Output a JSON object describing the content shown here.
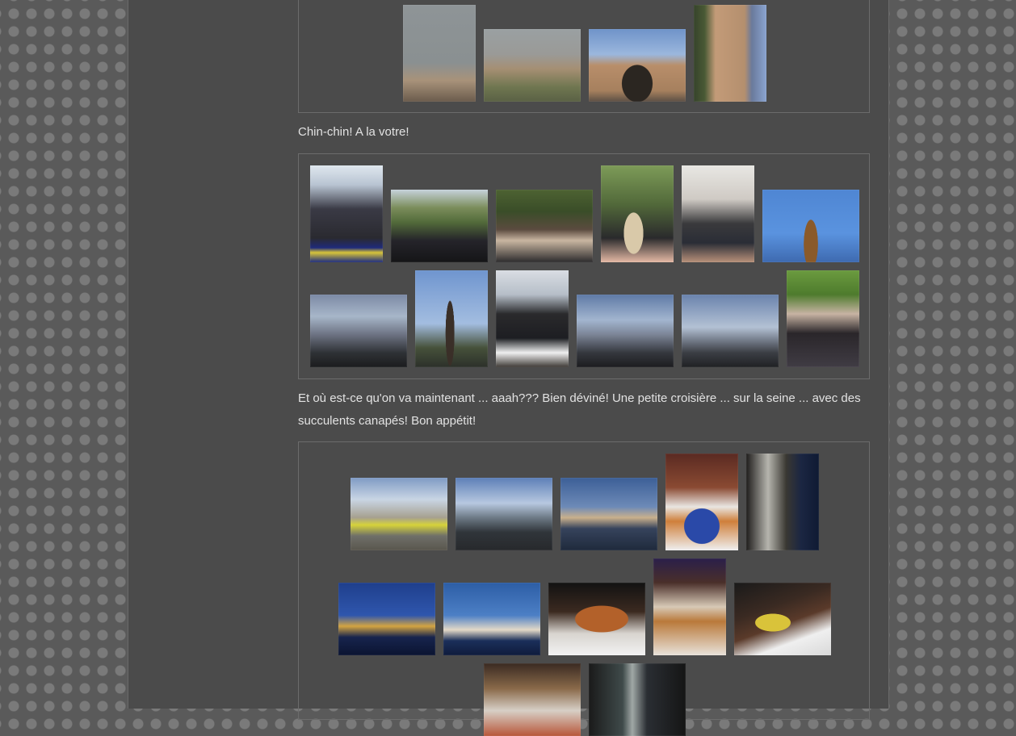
{
  "texts": {
    "caption_chinchin": "Chin-chin! A la votre!",
    "caption_croisiere": "Et où est-ce qu'on va maintenant ... aaah??? Bien déviné! Une petite croisière ... sur la seine ... avec des succulents canapés! Bon appétit!"
  },
  "gallery_top": {
    "photos": [
      {
        "name": "photo-paris-skyline-view",
        "bg": "linear-gradient(180deg,#8e9497 0%,#8a9091 60%,#a8927a 78%,#6b5c4d 100%)"
      },
      {
        "name": "photo-champs-elysees-aerial",
        "bg": "linear-gradient(180deg,#9aa0a2 0%,#9a9a97 35%,#a58f73 55%,#6f7650 80%,#5a6145 100%)"
      },
      {
        "name": "photo-arc-de-triomphe-front",
        "bg": "radial-gradient(ellipse 26% 42% at 50% 75%,#2b2621 60%,transparent 62%),linear-gradient(180deg,#6f93c9 0%,#9bb7dd 35%,#b88e6a 50%,#a6805e 85%,#5c4f45 100%)"
      },
      {
        "name": "photo-arc-de-triomphe-street",
        "bg": "linear-gradient(90deg,#36432b 0%,#4a5a35 15%,#c39b78 30%,#b48f6e 70%,#6a7a9c 80%,#8aa4d0 100%)"
      }
    ]
  },
  "gallery_bus": {
    "photos": [
      {
        "name": "photo-bus-upper-deck",
        "bg": "linear-gradient(180deg,#dfe7ee 0%,#b8c4d2 20%,#3a3a45 45%,#2a2a30 75%,#1f2a7a 85%,#d7c43a 90%,#1d2b7d 100%)"
      },
      {
        "name": "photo-bus-passengers-trees",
        "bg": "linear-gradient(180deg,#c6d2db 0%,#7b8d5b 25%,#526a3a 45%,#25242a 70%,#151517 100%)"
      },
      {
        "name": "photo-group-selfie-bus",
        "bg": "linear-gradient(180deg,#4d6232 0%,#3a4d28 30%,#5b4b3f 55%,#c9b6a1 70%,#2c2b2d 100%)"
      },
      {
        "name": "photo-champagne-glass",
        "bg": "radial-gradient(ellipse 22% 35% at 45% 70%,#d9c9a9 60%,transparent 62%),linear-gradient(180deg,#7d9b58 0%,#52693a 40%,#2a2a2c 75%,#e5b9a5 100%)"
      },
      {
        "name": "photo-toast-hands",
        "bg": "linear-gradient(180deg,#e8e7e3 0%,#cfcac4 35%,#3a3a3c 60%,#2a2d36 80%,#b8917a 100%)"
      },
      {
        "name": "photo-eiffel-tower-evening",
        "bg": "radial-gradient(ellipse 12% 55% at 50% 75%,#8a5a2a 60%,transparent 62%),linear-gradient(180deg,#4f86d3 0%,#5a93df 60%,#3e6ab0 100%)"
      },
      {
        "name": "photo-dusk-square",
        "bg": "linear-gradient(180deg,#7c8aa5 0%,#a7b6c9 30%,#6d7383 55%,#2f3236 80%,#1b1c1e 100%)"
      },
      {
        "name": "photo-eiffel-tower-tall",
        "bg": "radial-gradient(ellipse 10% 55% at 48% 65%,#3a2f28 60%,transparent 62%),linear-gradient(180deg,#6f95cf 0%,#a3bde0 55%,#46513a 80%,#2c302a 100%)"
      },
      {
        "name": "photo-woman-pouring",
        "bg": "linear-gradient(180deg,#d9dde3 0%,#b6bec8 25%,#2a2a2c 45%,#1d1e22 70%,#f0f0f0 85%,#3e3a36 100%)"
      },
      {
        "name": "photo-bridge-dusk",
        "bg": "linear-gradient(180deg,#5f7aa6 0%,#a2b5cf 35%,#7c8597 55%,#35383e 80%,#1c1c1f 100%)"
      },
      {
        "name": "photo-river-dusk",
        "bg": "linear-gradient(180deg,#6a83ad 0%,#b3c1d4 45%,#7e8796 60%,#3b3e44 80%,#202124 100%)"
      },
      {
        "name": "photo-woman-drinking",
        "bg": "linear-gradient(180deg,#6b9b3f 0%,#4e7b2d 25%,#c7b3a3 45%,#2a262a 65%,#403c44 100%)"
      }
    ]
  },
  "gallery_cruise": {
    "photos": [
      {
        "name": "photo-riverbank-building",
        "bg": "linear-gradient(180deg,#7f9bc4 0%,#c9d5e4 30%,#a6a08f 55%,#d6d33a 65%,#6f6f69 80%,#59564d 100%)"
      },
      {
        "name": "photo-boat-quay",
        "bg": "linear-gradient(180deg,#5d7fb7 0%,#b7c8e0 35%,#6d7a86 55%,#30353a 75%,#27292c 100%)"
      },
      {
        "name": "photo-seine-sunset",
        "bg": "linear-gradient(180deg,#3c5f97 0%,#6d8ab7 40%,#c9b08c 55%,#36435c 70%,#1f2a3c 100%)"
      },
      {
        "name": "photo-canapes-platter",
        "bg": "radial-gradient(ellipse 40% 30% at 50% 75%,#2a49a8 60%,transparent 62%),linear-gradient(180deg,#5a2a22 0%,#8a4a32 35%,#e9e6e2 55%,#cf7f3a 70%,#efefef 100%)"
      },
      {
        "name": "photo-night-boat-railing",
        "bg": "linear-gradient(90deg,#1f1d1c 0%,#b6b5ae 30%,#3a3832 55%,#1b2642 75%,#0f1a33 100%)"
      },
      {
        "name": "photo-pont-alexandre-night",
        "bg": "linear-gradient(180deg,#1f3f8c 0%,#2f56ad 45%,#d3a442 60%,#17244d 75%,#0b1431 100%)"
      },
      {
        "name": "photo-peniche-night",
        "bg": "linear-gradient(180deg,#2d5ea6 0%,#4c7fc5 45%,#e3d9c7 65%,#1b2f5a 80%,#0f1b3c 100%)"
      },
      {
        "name": "photo-canapes-tray",
        "bg": "radial-gradient(ellipse 45% 30% at 55% 50%,#b3612a 60%,transparent 62%),linear-gradient(180deg,#121212 0%,#3b2a20 40%,#d8d4cf 70%,#f2f2f2 100%)"
      },
      {
        "name": "photo-dessert-buffet",
        "bg": "linear-gradient(180deg,#2a1f4a 0%,#4a2f2a 25%,#d7c9b6 50%,#b9793a 65%,#e8e2da 100%)"
      },
      {
        "name": "photo-petits-fours",
        "bg": "radial-gradient(ellipse 30% 20% at 40% 55%,#d9c33a 60%,transparent 62%),linear-gradient(160deg,#1a1a1a 0%,#3a2a22 35%,#5a3a2a 55%,#efefef 75%,#d9d9d9 100%)"
      },
      {
        "name": "photo-buffet-table",
        "bg": "linear-gradient(180deg,#3a2a22 0%,#8a6a4a 35%,#d7cfc6 65%,#b8573a 100%)"
      },
      {
        "name": "photo-bottle-night",
        "bg": "linear-gradient(90deg,#1a1a1a 0%,#3f4a4a 35%,#a0a8a6 45%,#2a2e33 60%,#151515 100%)"
      }
    ]
  }
}
